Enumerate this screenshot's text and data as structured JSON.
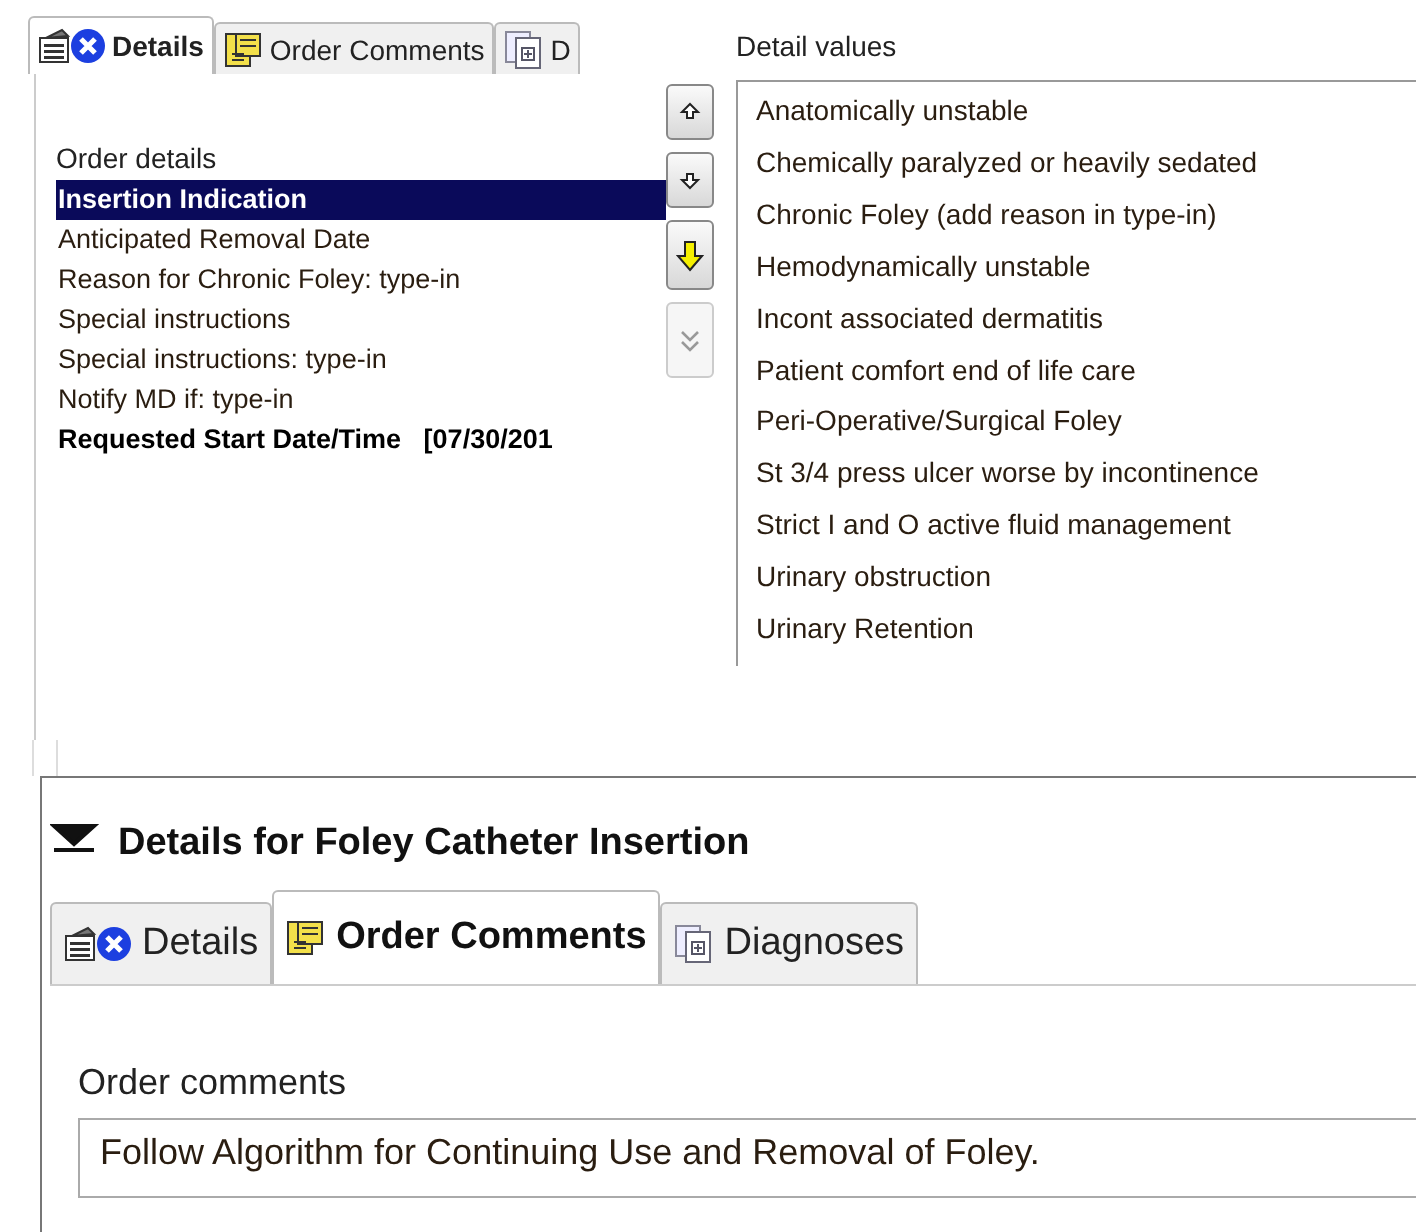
{
  "top_panel": {
    "tabs": [
      {
        "label": "Details",
        "selected": true,
        "kind": "details"
      },
      {
        "label": "Order Comments",
        "selected": false,
        "kind": "comments"
      },
      {
        "label": "D",
        "selected": false,
        "kind": "diagnoses"
      }
    ],
    "order_details": {
      "label": "Order details",
      "items": [
        {
          "label": "Insertion Indication",
          "selected": true,
          "required": true
        },
        {
          "label": "Anticipated Removal Date",
          "selected": false,
          "required": false
        },
        {
          "label": "Reason for Chronic Foley: type-in",
          "selected": false,
          "required": false
        },
        {
          "label": "Special instructions",
          "selected": false,
          "required": false
        },
        {
          "label": "Special instructions: type-in",
          "selected": false,
          "required": false
        },
        {
          "label": "Notify MD if: type-in",
          "selected": false,
          "required": false
        },
        {
          "label": "Requested Start Date/Time",
          "value": "[07/30/201",
          "selected": false,
          "required": true
        }
      ]
    },
    "move_buttons": [
      {
        "kind": "up",
        "disabled": false
      },
      {
        "kind": "down",
        "disabled": false
      },
      {
        "kind": "next",
        "disabled": false
      },
      {
        "kind": "last",
        "disabled": true
      }
    ],
    "detail_values": {
      "label": "Detail values",
      "items": [
        "Anatomically unstable",
        "Chemically paralyzed or heavily sedated",
        "Chronic Foley (add reason in type-in)",
        "Hemodynamically unstable",
        "Incont associated dermatitis",
        "Patient comfort end of life care",
        "Peri-Operative/Surgical Foley",
        "St 3/4 press ulcer worse by incontinence",
        "Strict I and O active fluid management",
        "Urinary obstruction",
        "Urinary Retention"
      ]
    }
  },
  "bottom_panel": {
    "title": "Details for Foley Catheter Insertion",
    "expanded": true,
    "tabs": [
      {
        "label": "Details",
        "selected": false,
        "kind": "details"
      },
      {
        "label": "Order Comments",
        "selected": true,
        "kind": "comments"
      },
      {
        "label": "Diagnoses",
        "selected": false,
        "kind": "diagnoses"
      }
    ],
    "order_comments": {
      "label": "Order comments",
      "value": "Follow Algorithm for Continuing Use and Removal of Foley."
    }
  }
}
